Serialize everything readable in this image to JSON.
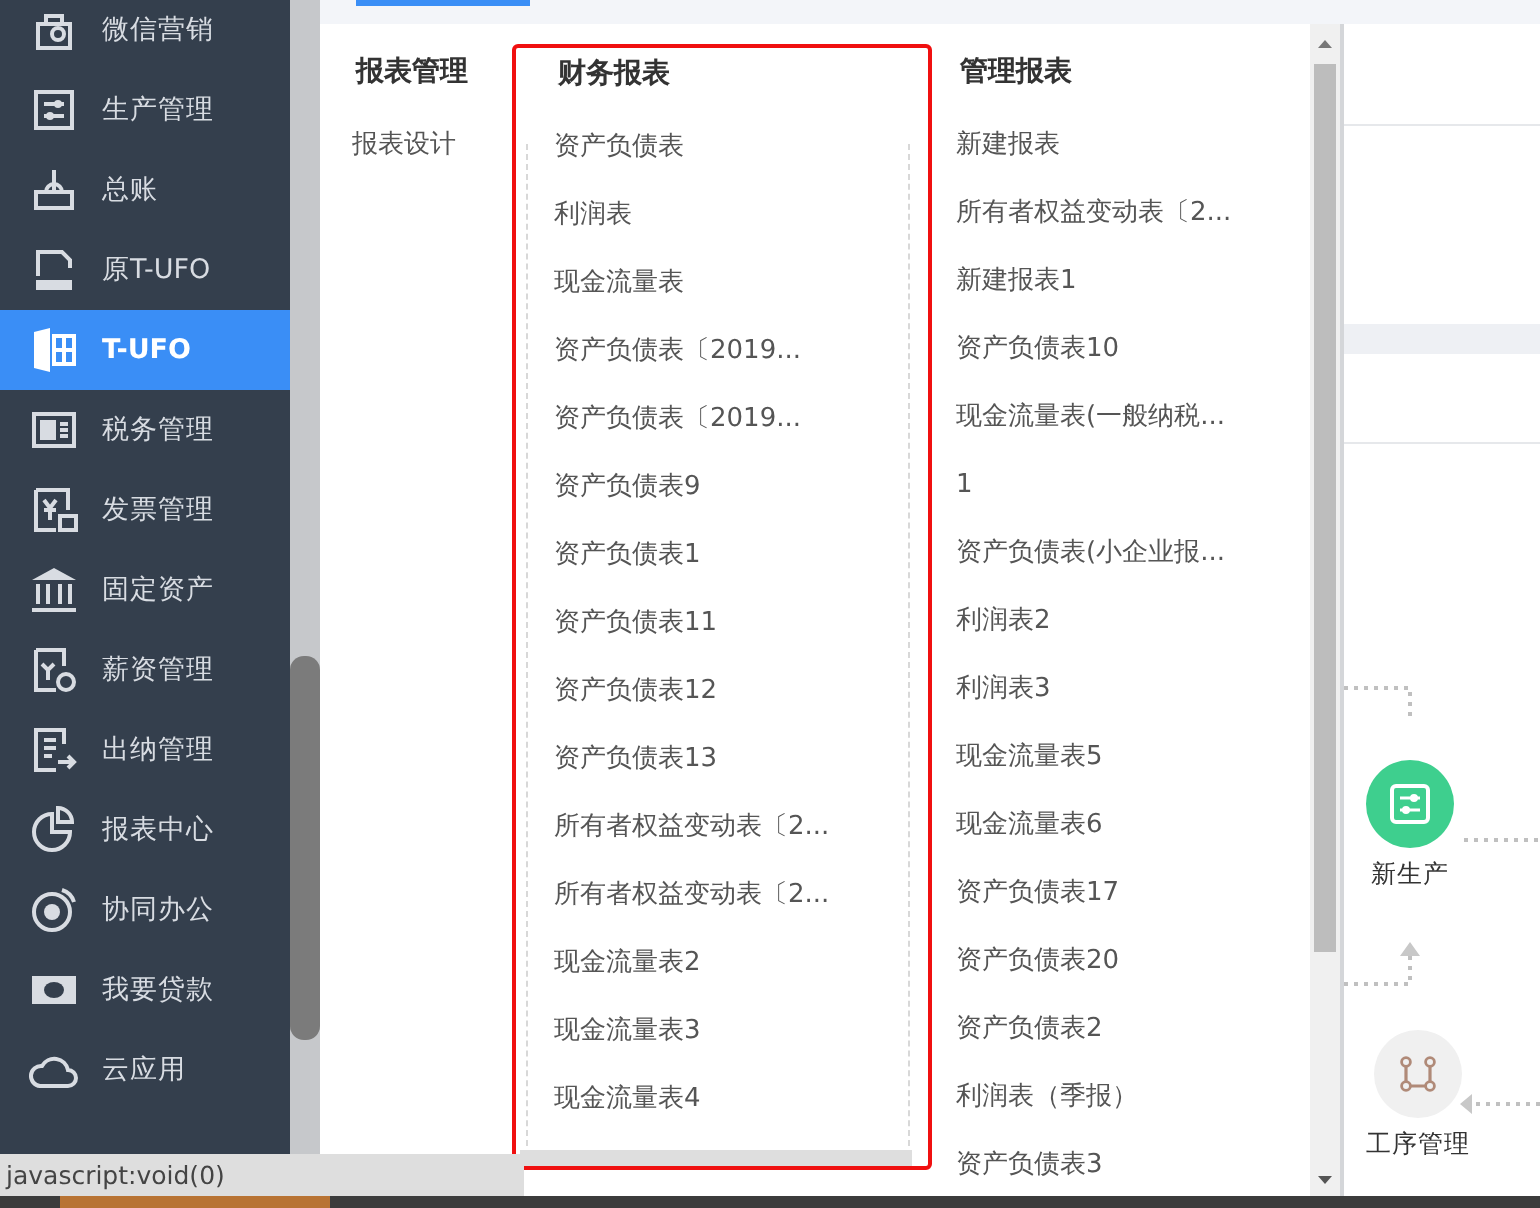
{
  "sidebar": {
    "items": [
      {
        "label": "微信营销",
        "selected": false
      },
      {
        "label": "生产管理",
        "selected": false
      },
      {
        "label": "总账",
        "selected": false
      },
      {
        "label": "原T-UFO",
        "selected": false
      },
      {
        "label": "T-UFO",
        "selected": true
      },
      {
        "label": "税务管理",
        "selected": false
      },
      {
        "label": "发票管理",
        "selected": false
      },
      {
        "label": "固定资产",
        "selected": false
      },
      {
        "label": "薪资管理",
        "selected": false
      },
      {
        "label": "出纳管理",
        "selected": false
      },
      {
        "label": "报表中心",
        "selected": false
      },
      {
        "label": "协同办公",
        "selected": false
      },
      {
        "label": "我要贷款",
        "selected": false
      },
      {
        "label": "云应用",
        "selected": false
      }
    ]
  },
  "menu": {
    "columns": [
      {
        "title": "报表管理",
        "highlighted": false,
        "items": [
          "报表设计"
        ]
      },
      {
        "title": "财务报表",
        "highlighted": true,
        "items": [
          "资产负债表",
          "利润表",
          "现金流量表",
          "资产负债表〔2019...",
          "资产负债表〔2019...",
          "资产负债表9",
          "资产负债表1",
          "资产负债表11",
          "资产负债表12",
          "资产负债表13",
          "所有者权益变动表〔2...",
          "所有者权益变动表〔2...",
          "现金流量表2",
          "现金流量表3",
          "现金流量表4"
        ]
      },
      {
        "title": "管理报表",
        "highlighted": false,
        "items": [
          "新建报表",
          "所有者权益变动表〔2...",
          "新建报表1",
          "资产负债表10",
          "现金流量表(一般纳税...",
          "1",
          "资产负债表(小企业报...",
          "利润表2",
          "利润表3",
          "现金流量表5",
          "现金流量表6",
          "资产负债表17",
          "资产负债表20",
          "资产负债表2",
          "利润表（季报）",
          "资产负债表3"
        ]
      }
    ]
  },
  "flow": {
    "nodes": [
      {
        "label": "新生产",
        "kind": "active"
      },
      {
        "label": "工序管理",
        "kind": "idle"
      }
    ]
  },
  "status_bar": {
    "text": "javascript:void(0)"
  }
}
